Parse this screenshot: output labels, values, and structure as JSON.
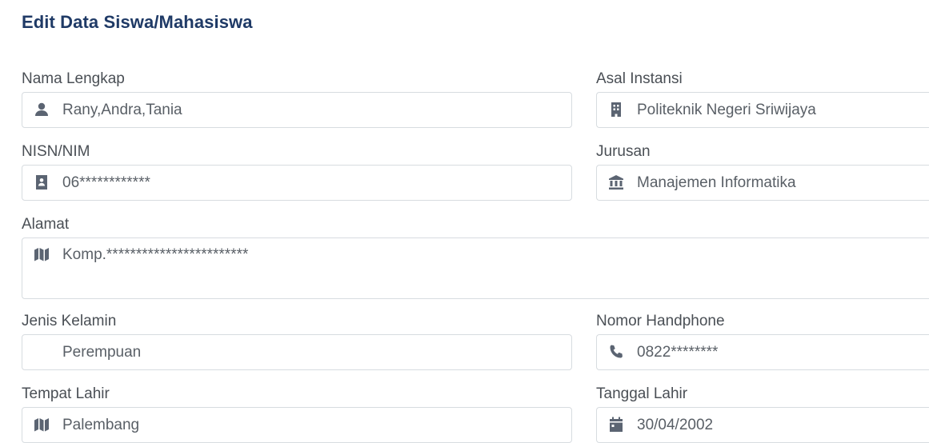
{
  "page": {
    "title": "Edit Data Siswa/Mahasiswa"
  },
  "fields": {
    "nama": {
      "label": "Nama Lengkap",
      "value": "Rany,Andra,Tania",
      "icon": "user-icon"
    },
    "instansi": {
      "label": "Asal Instansi",
      "value": "Politeknik Negeri Sriwijaya",
      "icon": "building-icon"
    },
    "nim": {
      "label": "NISN/NIM",
      "value": "06************",
      "icon": "id-card-icon"
    },
    "jurusan": {
      "label": "Jurusan",
      "value": "Manajemen Informatika",
      "icon": "institution-icon"
    },
    "alamat": {
      "label": "Alamat",
      "value": "Komp.************************",
      "icon": "map-icon"
    },
    "kelamin": {
      "label": "Jenis Kelamin",
      "value": "Perempuan"
    },
    "hp": {
      "label": "Nomor Handphone",
      "value": "0822********",
      "icon": "phone-icon"
    },
    "tempat": {
      "label": "Tempat Lahir",
      "value": "Palembang",
      "icon": "map-icon"
    },
    "tanggal": {
      "label": "Tanggal Lahir",
      "value": "30/04/2002",
      "icon": "calendar-icon"
    }
  }
}
